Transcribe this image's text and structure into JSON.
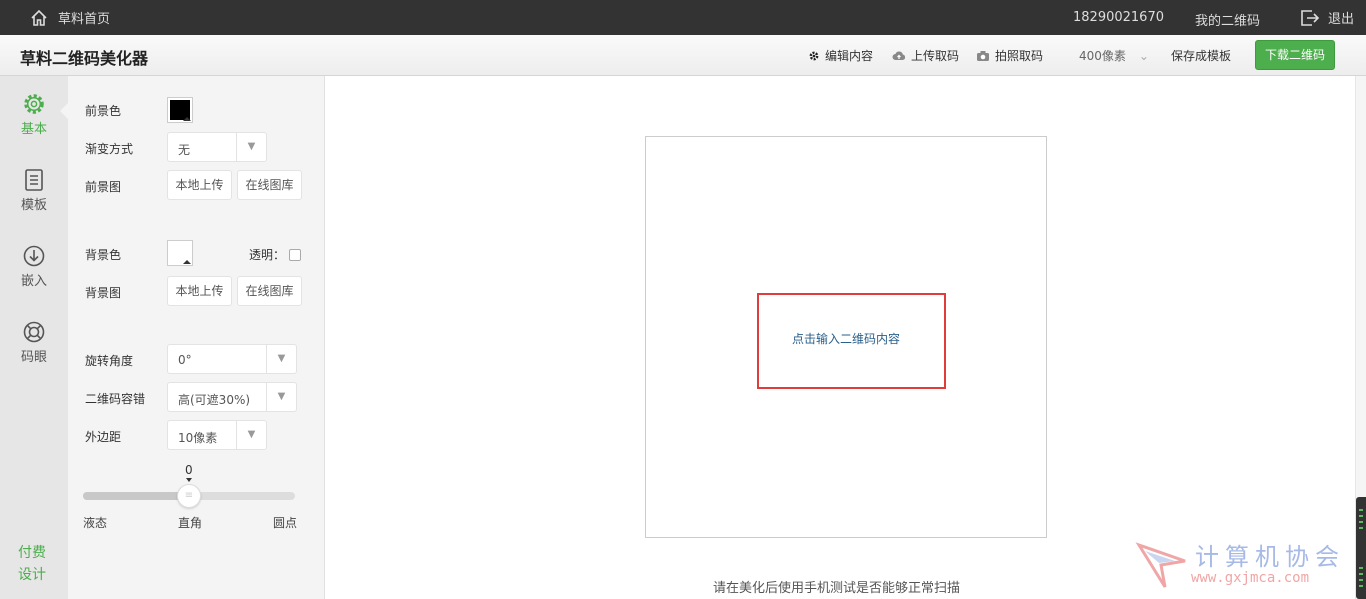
{
  "topbar": {
    "home_label": "草料首页",
    "phone": "18290021670",
    "my_qr": "我的二维码",
    "logout": "退出"
  },
  "header": {
    "title": "草料二维码美化器",
    "edit": "编辑内容",
    "upload": "上传取码",
    "photo": "拍照取码",
    "size": "400像素",
    "save_template": "保存成模板",
    "download": "下载二维码"
  },
  "nav": {
    "basic": "基本",
    "template": "模板",
    "embed": "嵌入",
    "eye": "码眼",
    "paid_1": "付费",
    "paid_2": "设计"
  },
  "panel": {
    "fg_color_label": "前景色",
    "fg_color": "#000000",
    "gradient_label": "渐变方式",
    "gradient_value": "无",
    "fg_image_label": "前景图",
    "local_upload": "本地上传",
    "online_gallery": "在线图库",
    "bg_color_label": "背景色",
    "bg_color": "#ffffff",
    "transparent_label": "透明：",
    "bg_image_label": "背景图",
    "rotation_label": "旋转角度",
    "rotation_value": "0°",
    "error_label": "二维码容错",
    "error_value": "高(可遮30%)",
    "margin_label": "外边距",
    "margin_value": "10像素",
    "slider_value": "0",
    "slider_left": "液态",
    "slider_mid": "直角",
    "slider_right": "圆点"
  },
  "canvas": {
    "prompt": "点击输入二维码内容",
    "hint": "请在美化后使用手机测试是否能够正常扫描"
  },
  "watermark": {
    "text": "计算机协会",
    "url": "www.gxjmca.com"
  },
  "colors": {
    "accent": "#4cae4c",
    "topbar": "#333333",
    "prompt_border": "#e03c3c"
  }
}
